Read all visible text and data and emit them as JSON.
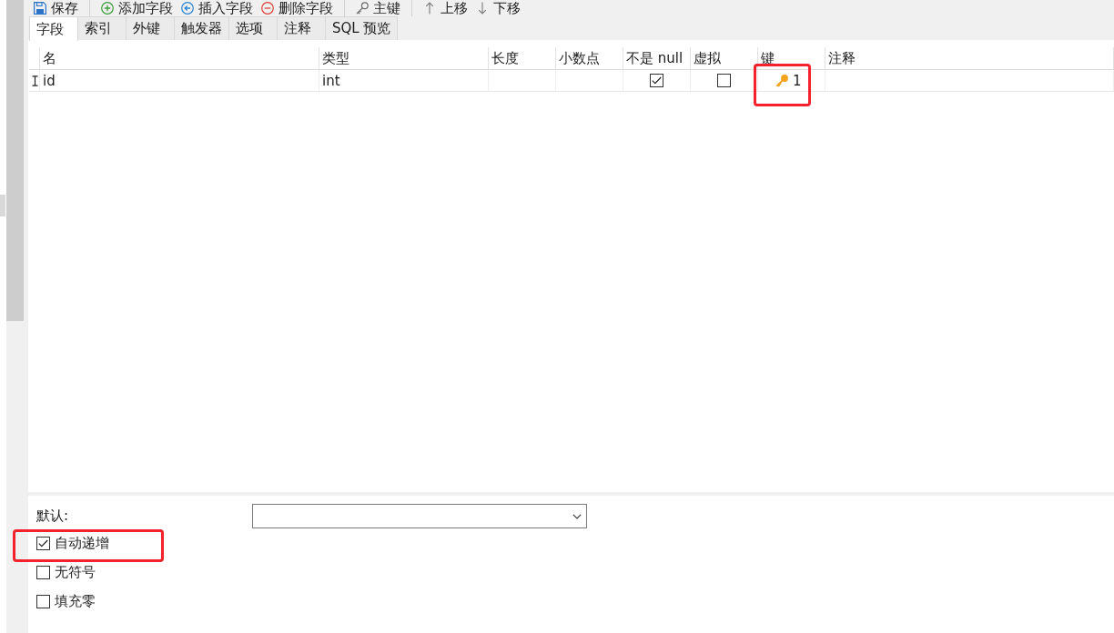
{
  "toolbar": {
    "groups": [
      [
        {
          "kind": "save",
          "label": "保存"
        }
      ],
      [
        {
          "kind": "add",
          "label": "添加字段"
        },
        {
          "kind": "insert",
          "label": "插入字段"
        },
        {
          "kind": "delete",
          "label": "删除字段"
        }
      ],
      [
        {
          "kind": "key",
          "label": "主键"
        }
      ],
      [
        {
          "kind": "up",
          "label": "上移"
        },
        {
          "kind": "down",
          "label": "下移"
        }
      ]
    ]
  },
  "tabs": [
    {
      "label": "字段",
      "selected": true
    },
    {
      "label": "索引",
      "selected": false
    },
    {
      "label": "外键",
      "selected": false
    },
    {
      "label": "触发器",
      "selected": false
    },
    {
      "label": "选项",
      "selected": false
    },
    {
      "label": "注释",
      "selected": false
    },
    {
      "label": "SQL 预览",
      "selected": false
    }
  ],
  "table": {
    "columns": [
      {
        "label": "名"
      },
      {
        "label": "类型"
      },
      {
        "label": "长度"
      },
      {
        "label": "小数点"
      },
      {
        "label": "不是 null"
      },
      {
        "label": "虚拟"
      },
      {
        "label": "键"
      },
      {
        "label": "注释"
      }
    ],
    "rows": [
      {
        "current": true,
        "cells": [
          {
            "kind": "text",
            "text": "id"
          },
          {
            "kind": "text",
            "text": "int"
          },
          {
            "kind": "blank"
          },
          {
            "kind": "blank"
          },
          {
            "kind": "checkbox",
            "checked": true
          },
          {
            "kind": "checkbox",
            "checked": false
          },
          {
            "kind": "key",
            "text": "1",
            "highlighted": true
          },
          {
            "kind": "blank"
          }
        ]
      }
    ]
  },
  "field_properties": {
    "default": {
      "label": "默认:"
    },
    "options": [
      {
        "label": "自动递增",
        "checked": true,
        "highlighted": true
      },
      {
        "label": "无符号",
        "checked": false,
        "highlighted": false
      },
      {
        "label": "填充零",
        "checked": false,
        "highlighted": false
      }
    ]
  }
}
